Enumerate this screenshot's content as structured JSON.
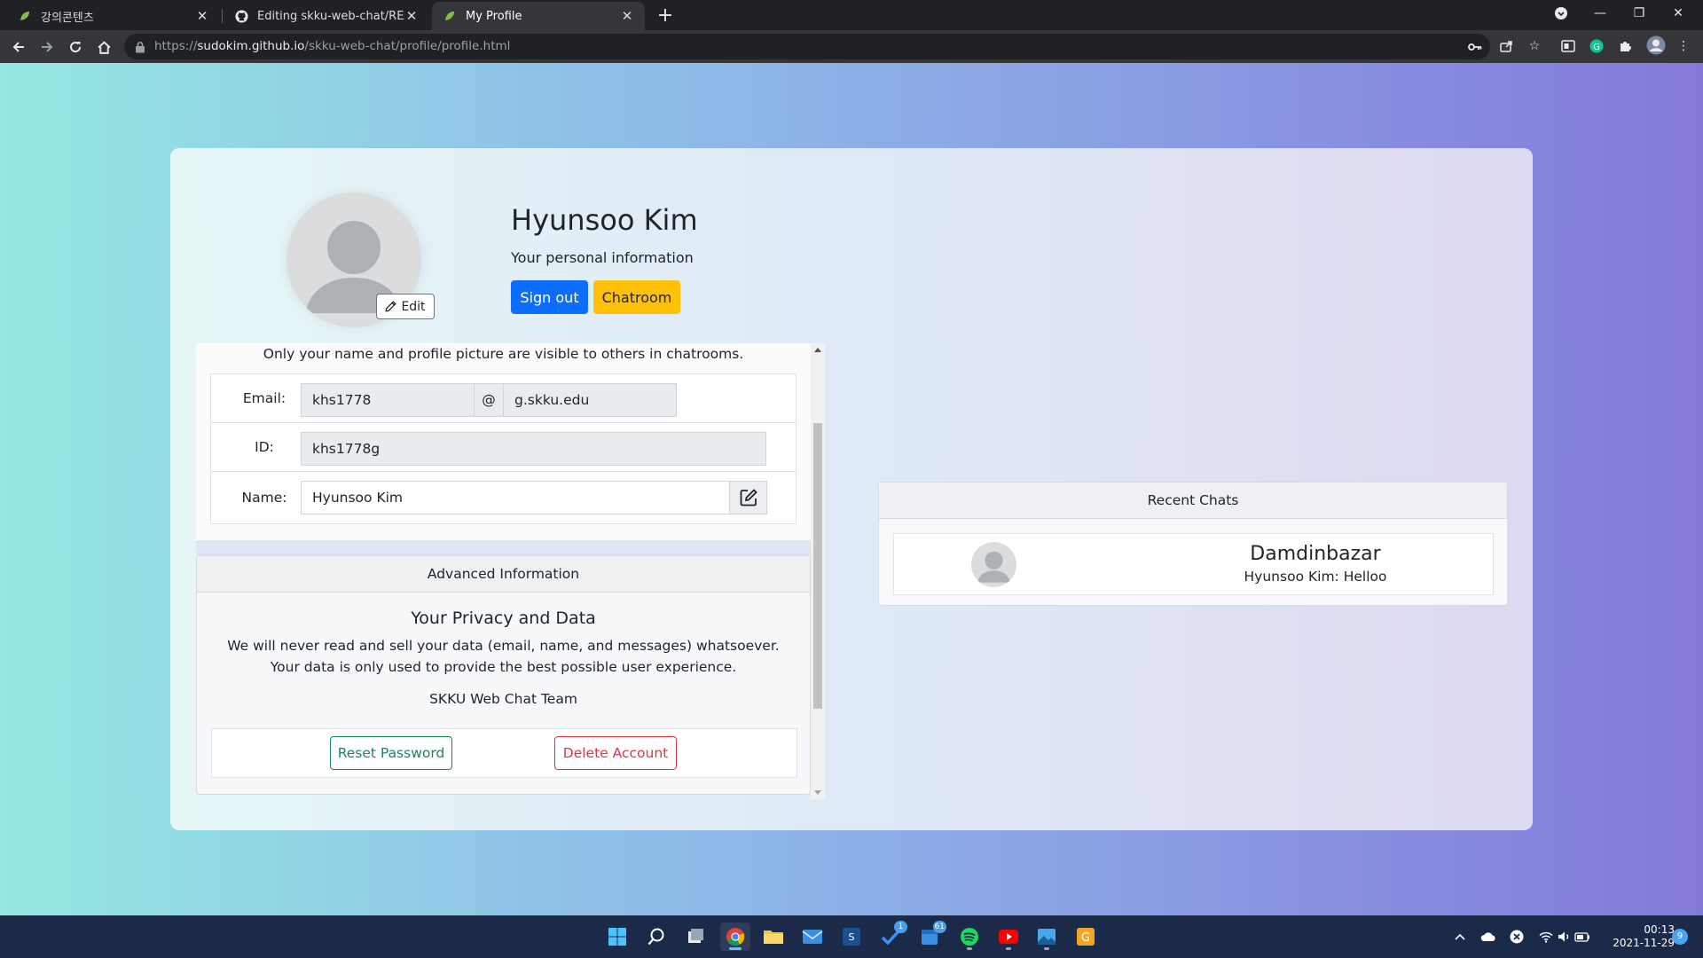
{
  "browser": {
    "tabs": [
      {
        "title": "강의콘텐츠",
        "icon": "leaf-favicon-icon"
      },
      {
        "title": "Editing skku-web-chat/README",
        "icon": "github-icon"
      },
      {
        "title": "My Profile",
        "icon": "leaf-favicon-icon"
      }
    ],
    "url_prefix": "https://",
    "url_host": "sudokim.github.io",
    "url_path": "/skku-web-chat/profile/profile.html"
  },
  "profile": {
    "name": "Hyunsoo Kim",
    "subtitle": "Your personal information",
    "edit_label": "Edit",
    "signout_label": "Sign out",
    "chatroom_label": "Chatroom",
    "visibility_note": "Only your name and profile picture are visible to others in chatrooms."
  },
  "info": {
    "email_label": "Email:",
    "email_user": "khs1778",
    "email_at": "@",
    "email_domain": "g.skku.edu",
    "id_label": "ID:",
    "id_value": "khs1778g",
    "name_label": "Name:",
    "name_value": "Hyunsoo Kim"
  },
  "advanced": {
    "header": "Advanced Information",
    "privacy_title": "Your Privacy and Data",
    "privacy_text": "We will never read and sell your data (email, name, and messages) whatsoever. Your data is only used to provide the best possible user experience.",
    "team": "SKKU Web Chat Team",
    "reset_label": "Reset Password",
    "delete_label": "Delete Account"
  },
  "recent_chats": {
    "header": "Recent Chats",
    "items": [
      {
        "name": "Damdinbazar",
        "preview": "Hyunsoo Kim: Helloo"
      }
    ]
  },
  "taskbar": {
    "todo_badge": "1",
    "calendar_badge": "61",
    "clock_time": "00:13",
    "clock_date": "2021-11-29",
    "notification_count": "9"
  },
  "colors": {
    "primary": "#0d6efd",
    "warning": "#ffc107",
    "success": "#198754",
    "danger": "#dc3545"
  }
}
